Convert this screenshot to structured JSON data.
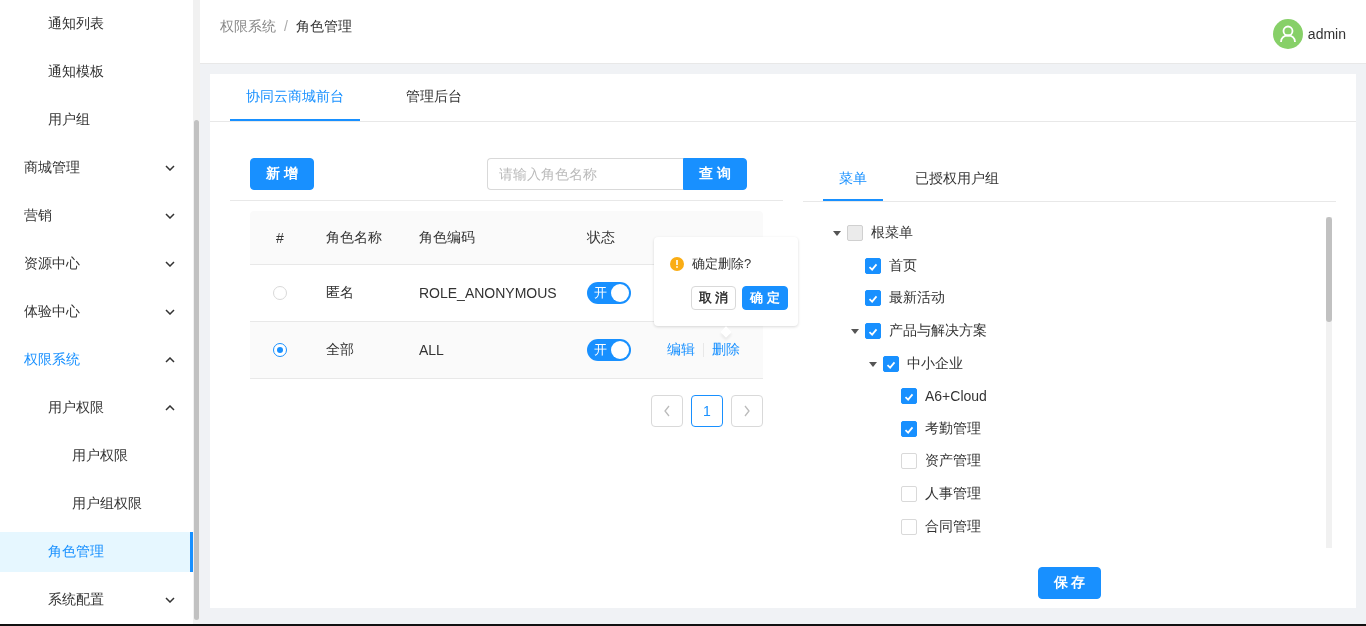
{
  "sidebar": {
    "items": [
      {
        "children": [
          {
            "label": "通知列表",
            "selected": false
          },
          {
            "label": "通知模板",
            "selected": false
          },
          {
            "label": "用户组",
            "selected": false
          }
        ]
      },
      {
        "label": "商城管理",
        "selected": false,
        "expanded": false
      },
      {
        "label": "营销",
        "selected": false,
        "expanded": false
      },
      {
        "label": "资源中心",
        "selected": false,
        "expanded": false
      },
      {
        "label": "体验中心",
        "selected": false,
        "expanded": false
      },
      {
        "label": "权限系统",
        "selected": false,
        "expanded": true,
        "active": true,
        "children": [
          {
            "label": "用户权限",
            "selected": false,
            "expanded": true,
            "children": [
              {
                "label": "用户权限",
                "selected": false
              },
              {
                "label": "用户组权限",
                "selected": false
              }
            ]
          },
          {
            "label": "角色管理",
            "selected": true
          },
          {
            "label": "系统配置",
            "selected": false,
            "expanded": false
          }
        ]
      }
    ]
  },
  "header": {
    "breadcrumb": [
      "权限系统",
      "角色管理"
    ],
    "separator": "/",
    "user": "admin"
  },
  "tabs": [
    {
      "label": "协同云商城前台",
      "selected": true
    },
    {
      "label": "管理后台",
      "selected": false
    }
  ],
  "toolbar": {
    "add_button": "新 增",
    "search": {
      "placeholder": "请输入角色名称"
    },
    "search_button": "查 询"
  },
  "table": {
    "columns": [
      "#",
      "角色名称",
      "角色编码",
      "状态"
    ],
    "rows": [
      {
        "selected": false,
        "name": "匿名",
        "code": "ROLE_ANONYMOUS",
        "status": {
          "on": true,
          "label": "开"
        },
        "actions": []
      },
      {
        "selected": true,
        "name": "全部",
        "code": "ALL",
        "status": {
          "on": true,
          "label": "开"
        },
        "actions": [
          "编辑",
          "删除"
        ]
      }
    ]
  },
  "pagination": {
    "pages": [
      {
        "label": "1",
        "selected": true
      }
    ]
  },
  "popconfirm": {
    "message": "确定删除?",
    "cancel": "取 消",
    "ok": "确 定"
  },
  "right_tabs": [
    {
      "label": "菜单",
      "selected": true
    },
    {
      "label": "已授权用户组",
      "selected": false
    }
  ],
  "tree": [
    {
      "label": "根菜单",
      "checked": false,
      "disabled": true,
      "expanded": true,
      "children": [
        {
          "label": "首页",
          "checked": true
        },
        {
          "label": "最新活动",
          "checked": true
        },
        {
          "label": "产品与解决方案",
          "checked": true,
          "expanded": true,
          "children": [
            {
              "label": "中小企业",
              "checked": true,
              "expanded": true,
              "children": [
                {
                  "label": "A6+Cloud",
                  "checked": true
                },
                {
                  "label": "考勤管理",
                  "checked": true
                },
                {
                  "label": "资产管理",
                  "checked": false
                },
                {
                  "label": "人事管理",
                  "checked": false
                },
                {
                  "label": "合同管理",
                  "checked": false
                }
              ]
            }
          ]
        }
      ]
    }
  ],
  "save_button": "保 存"
}
